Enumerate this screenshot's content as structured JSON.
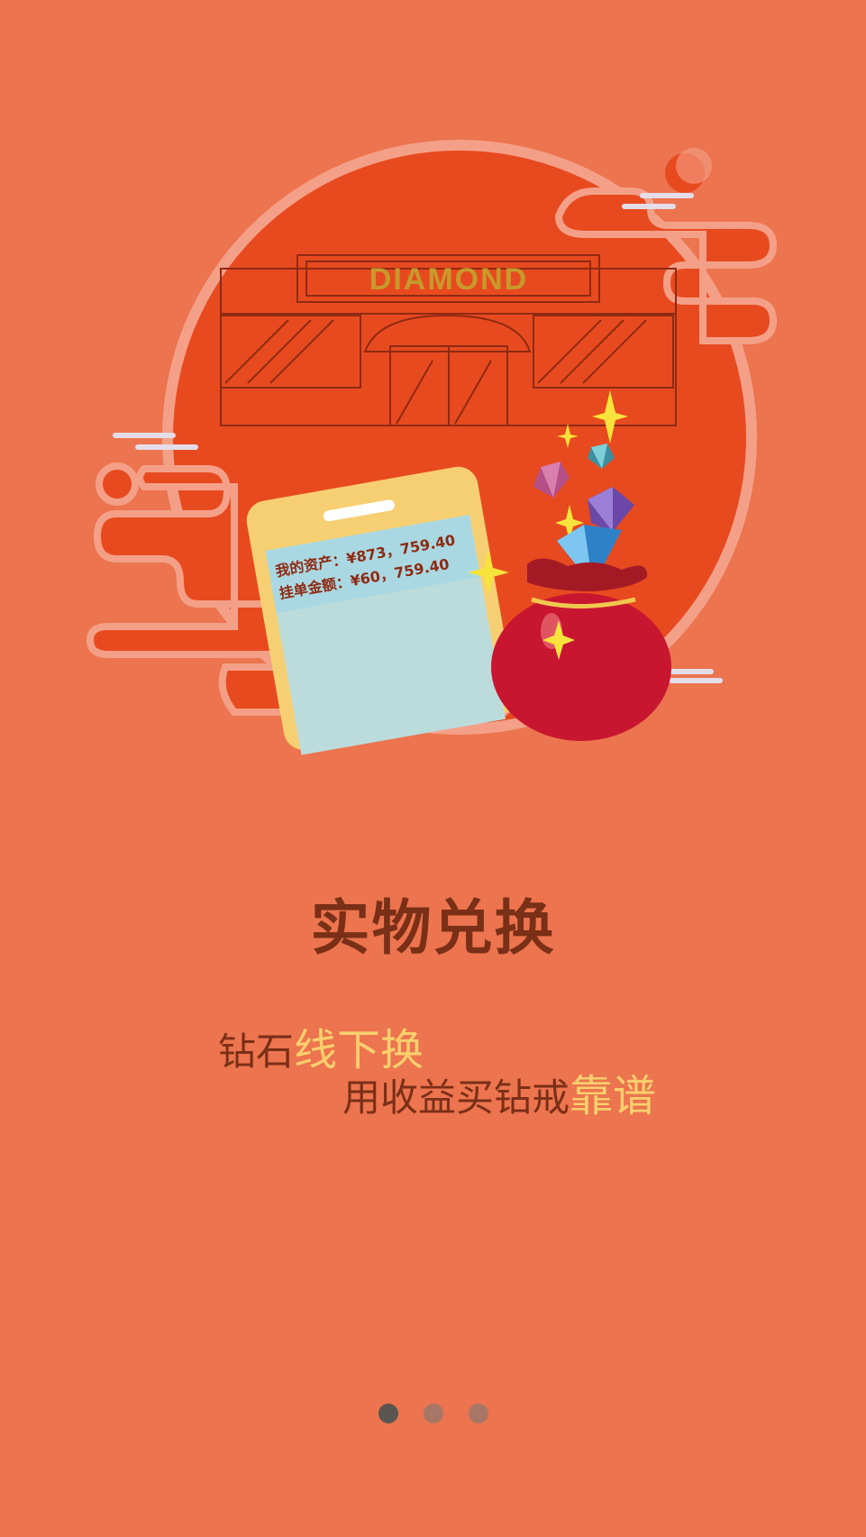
{
  "illustration": {
    "store_sign": "DIAMOND",
    "phone_asset": "我的资产：¥873，759.40",
    "phone_order": "挂单金额：¥60，759.40"
  },
  "onboarding": {
    "title": "实物兑换",
    "line1_part1": "钻石",
    "line1_part2": "线下换",
    "line2_part1": "用收益买钻戒",
    "line2_part2": "靠谱"
  },
  "pager": {
    "total": 3,
    "active_index": 0
  },
  "colors": {
    "background": "#ec744e",
    "circle": "#e84a1f",
    "title": "#7a2f17",
    "highlight": "#f9cf6d",
    "dot_active": "#5b5552",
    "dot_inactive": "#a87666"
  }
}
